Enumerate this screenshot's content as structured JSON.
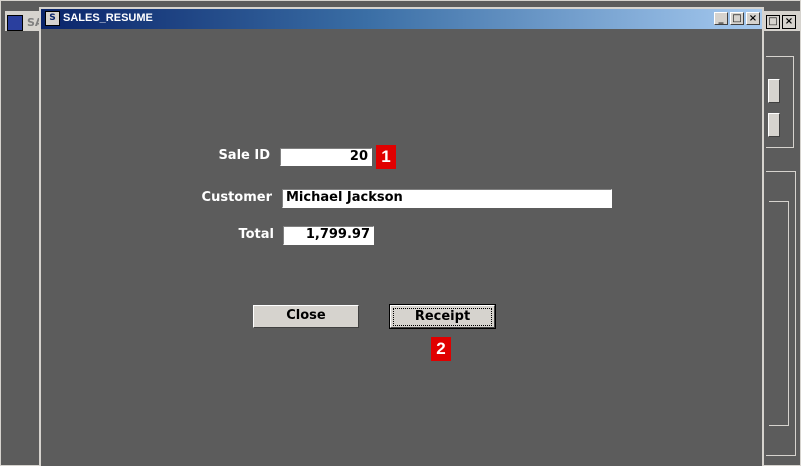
{
  "background_window": {
    "title": "SA",
    "buttons": [
      "□",
      "×"
    ]
  },
  "window": {
    "title": "SALES_RESUME",
    "buttons": {
      "minimize": "_",
      "maximize": "□",
      "close": "×"
    }
  },
  "form": {
    "sale_id": {
      "label": "Sale ID",
      "value": "20"
    },
    "customer": {
      "label": "Customer",
      "value": "Michael Jackson"
    },
    "total": {
      "label": "Total",
      "value": "1,799.97"
    }
  },
  "actions": {
    "close_label": "Close",
    "receipt_label": "Receipt"
  },
  "markers": [
    "1",
    "2"
  ],
  "colors": {
    "background": "#5c5c5c",
    "title_gradient_start": "#0a246a",
    "title_gradient_end": "#a6caf0",
    "button_face": "#d6d3ce",
    "marker": "#e00000"
  }
}
